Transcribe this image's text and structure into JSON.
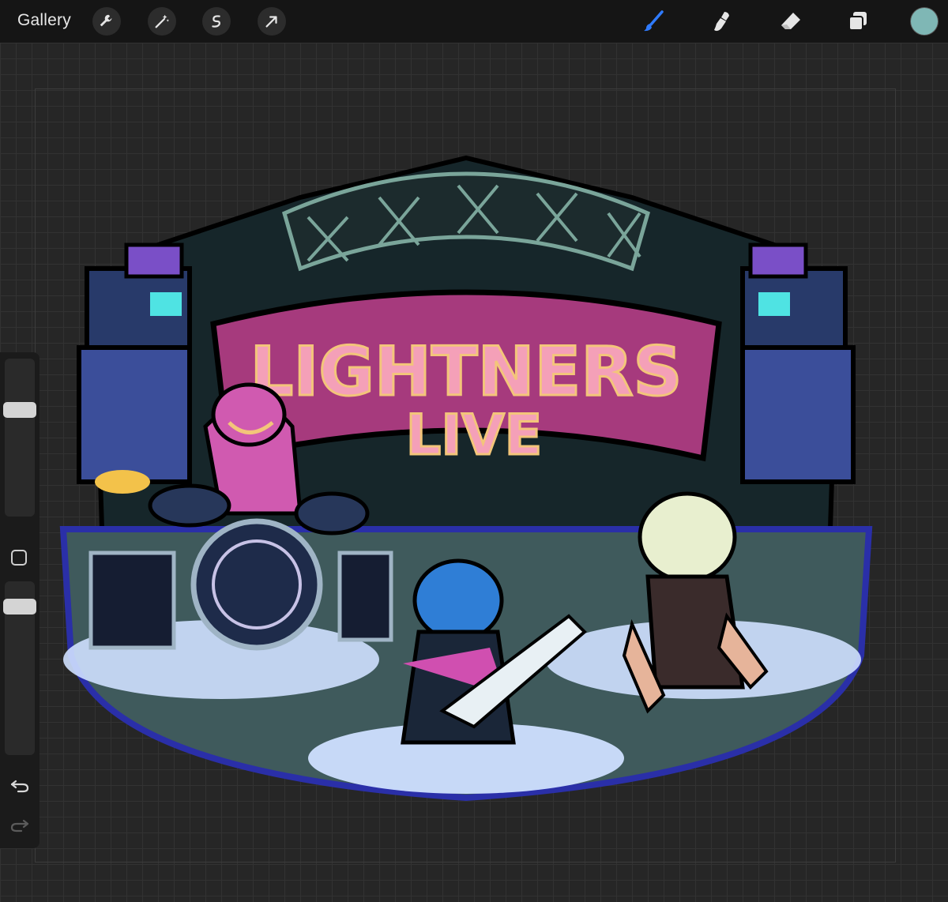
{
  "toolbar": {
    "gallery_label": "Gallery",
    "left_tools": [
      "wrench-icon",
      "magic-wand-icon",
      "selection-icon",
      "transform-arrow-icon"
    ],
    "right_tools": [
      "brush-icon",
      "smudge-icon",
      "eraser-icon",
      "layers-icon"
    ],
    "active_tool": "brush-icon",
    "active_tool_color": "#2f7bff",
    "current_color": "#7fb7b5"
  },
  "sidebar": {
    "brush_size": 0.46,
    "opacity": 0.17,
    "controls": [
      "modify-square-icon",
      "undo-icon",
      "redo-icon"
    ]
  },
  "artwork": {
    "sign_line_1": "LIGHTNERS",
    "sign_line_2": "LIVE",
    "colors": {
      "stage_border": "#2a2fa8",
      "sign_fill": "#a63a7d",
      "sign_text": "#f4a0b8",
      "spotlight": "#cfe0ff"
    }
  }
}
